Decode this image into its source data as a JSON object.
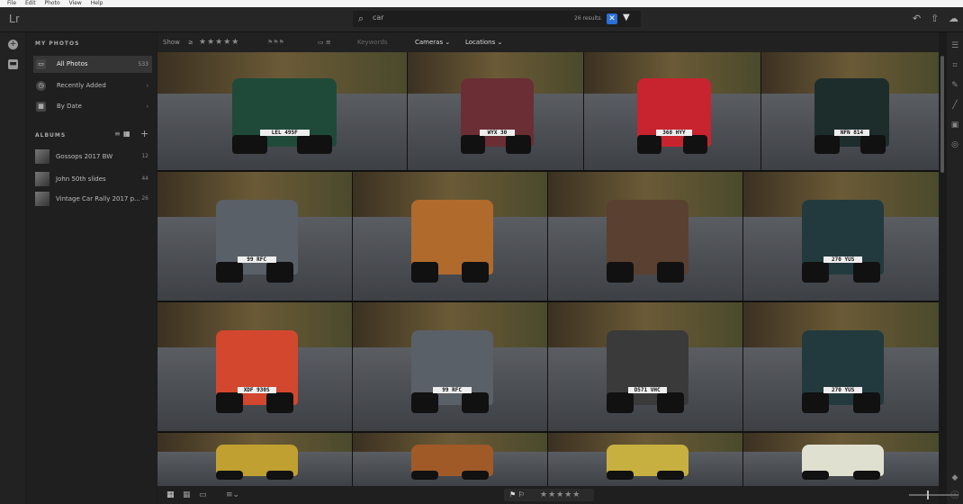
{
  "menubar": {
    "items": [
      "File",
      "Edit",
      "Photo",
      "View",
      "Help"
    ]
  },
  "topbar": {
    "logo": "Lr",
    "search_value": "car",
    "results_text": "26 results",
    "clear_glyph": "✕",
    "filter_glyph": "▼"
  },
  "sidebar": {
    "my_photos_header": "MY PHOTOS",
    "items": [
      {
        "label": "All Photos",
        "count": "533"
      },
      {
        "label": "Recently Added",
        "count": "›"
      },
      {
        "label": "By Date",
        "count": "›"
      }
    ],
    "albums_header": "ALBUMS",
    "albums_add": "+",
    "albums": [
      {
        "label": "Gossops 2017 BW",
        "count": "12"
      },
      {
        "label": "John 50th slides",
        "count": "44"
      },
      {
        "label": "Vintage Car Rally 2017 p...",
        "count": "26"
      }
    ]
  },
  "toolbar": {
    "show_label": "Show",
    "rating_value": "≥",
    "stars": "★★★★★",
    "flags": "⚑⚑⚑",
    "keywords": "Keywords",
    "cameras": "Cameras ⌄",
    "locations": "Locations ⌄"
  },
  "photos": [
    {
      "plate": "LEL 495F",
      "color": "#1f4a3a"
    },
    {
      "plate": "WYX 30",
      "color": "#6b2e35"
    },
    {
      "plate": "368 HYY",
      "color": "#c8242f"
    },
    {
      "plate": "NFN 814",
      "color": "#1c2d2c"
    },
    {
      "plate": "99 RFC",
      "color": "#5a6068"
    },
    {
      "plate": "",
      "color": "#b06a2c"
    },
    {
      "plate": "",
      "color": "#5a4030"
    },
    {
      "plate": "270 YUS",
      "color": "#223a3e"
    },
    {
      "plate": "XDF 930S",
      "color": "#d3472e"
    },
    {
      "plate": "99 RFC",
      "color": "#5a6068"
    },
    {
      "plate": "D571 VHC",
      "color": "#3a3a3a"
    },
    {
      "plate": "270 YUS",
      "color": "#223a3e"
    },
    {
      "plate": "",
      "color": "#c0a030"
    },
    {
      "plate": "",
      "color": "#a05a28"
    },
    {
      "plate": "",
      "color": "#c8b040"
    },
    {
      "plate": "",
      "color": "#e0e0d0"
    }
  ],
  "bottombar": {
    "flag_stars": "★★★★★",
    "flag_icons": "⚑ ⚐"
  }
}
